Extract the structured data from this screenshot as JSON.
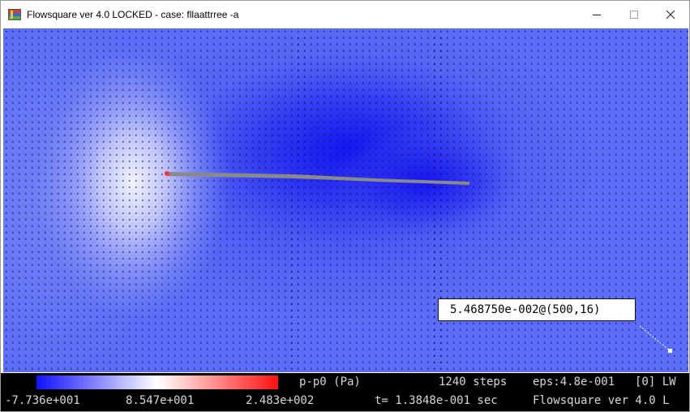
{
  "window": {
    "title": "Flowsquare ver 4.0 LOCKED - case: fllaattrree -a",
    "app_icon": "flowsquare-app-icon",
    "controls": [
      "minimize-icon",
      "maximize-icon",
      "close-icon"
    ]
  },
  "simulation": {
    "probe_readout": "5.468750e-002@(500,16)"
  },
  "status": {
    "variable_label": "p-p0 (Pa)",
    "steps": "1240 steps",
    "eps": "eps:4.8e-001",
    "mode": "[0] LW",
    "scale_min": "-7.736e+001",
    "scale_mid": "8.547e+001",
    "scale_max": "2.483e+002",
    "time": "t= 1.3848e-001 sec",
    "app_name": "Flowsquare ver 4.0 L"
  },
  "colors": {
    "colormap_low": "#1010ff",
    "colormap_mid": "#ffffff",
    "colormap_high": "#ff1010",
    "field_background": "#5a6cf6",
    "plate": "#8a8a8a",
    "status_background": "#000000",
    "status_text": "#d8d8d8"
  }
}
